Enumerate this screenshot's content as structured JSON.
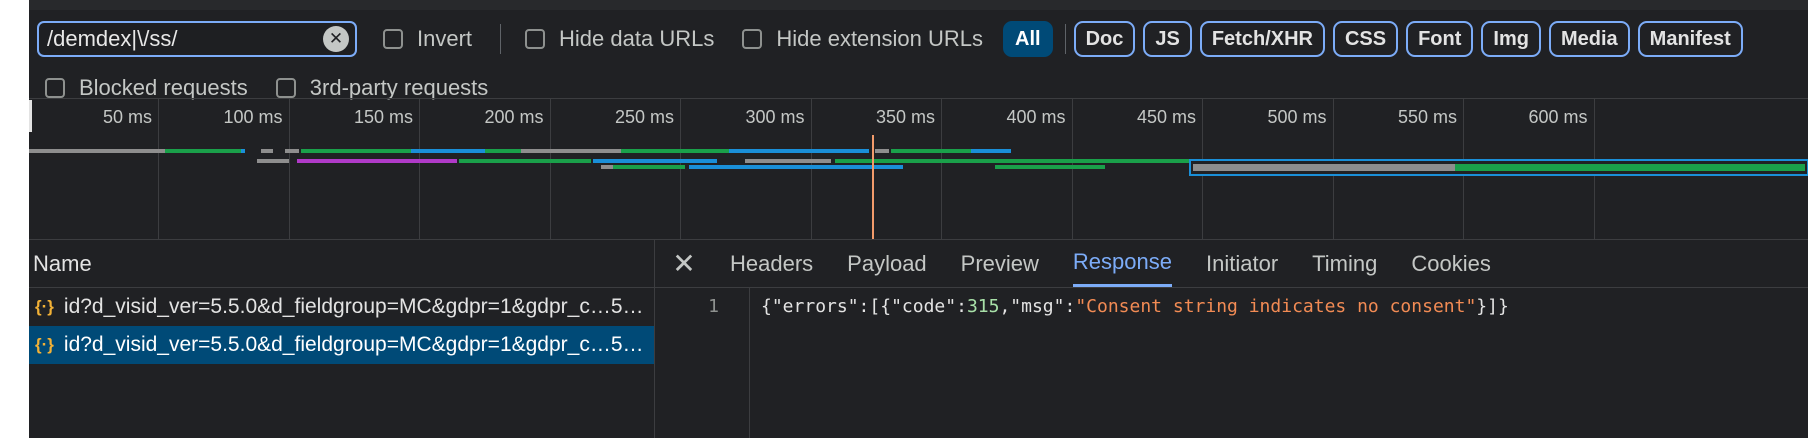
{
  "filter": {
    "value": "/demdex|\\/ss/",
    "invert": "Invert",
    "hide_data_urls": "Hide data URLs",
    "hide_extension_urls": "Hide extension URLs",
    "types": [
      "All",
      "Doc",
      "JS",
      "Fetch/XHR",
      "CSS",
      "Font",
      "Img",
      "Media",
      "Manifest"
    ],
    "blocked": "Blocked requests",
    "third_party": "3rd-party requests"
  },
  "timeline": {
    "ticks": [
      "50 ms",
      "100 ms",
      "150 ms",
      "200 ms",
      "250 ms",
      "300 ms",
      "350 ms",
      "400 ms",
      "450 ms",
      "500 ms",
      "550 ms",
      "600 ms"
    ]
  },
  "requests": {
    "header": "Name",
    "rows": [
      {
        "name": "id?d_visid_ver=5.5.0&d_fieldgroup=MC&gdpr=1&gdpr_c…5…"
      },
      {
        "name": "id?d_visid_ver=5.5.0&d_fieldgroup=MC&gdpr=1&gdpr_c…5…"
      }
    ]
  },
  "detail": {
    "tabs": [
      "Headers",
      "Payload",
      "Preview",
      "Response",
      "Initiator",
      "Timing",
      "Cookies"
    ],
    "active_tab": "Response",
    "line_number": "1",
    "response": {
      "p1": "{",
      "k_errors": "\"errors\"",
      "p2": ":[{",
      "k_code": "\"code\"",
      "p3": ":",
      "v_code": "315",
      "p4": ",",
      "k_msg": "\"msg\"",
      "p5": ":",
      "v_msg": "\"Consent string indicates no consent\"",
      "p6": "}]}"
    }
  },
  "colors": {
    "accent": "#7cacf8",
    "selected": "#004a77",
    "bar_gray": "#8e8e8e",
    "bar_green": "#1aa04a",
    "bar_blue": "#1a8fd8",
    "bar_purple": "#b03ac8",
    "marker": "#f29b6b"
  }
}
